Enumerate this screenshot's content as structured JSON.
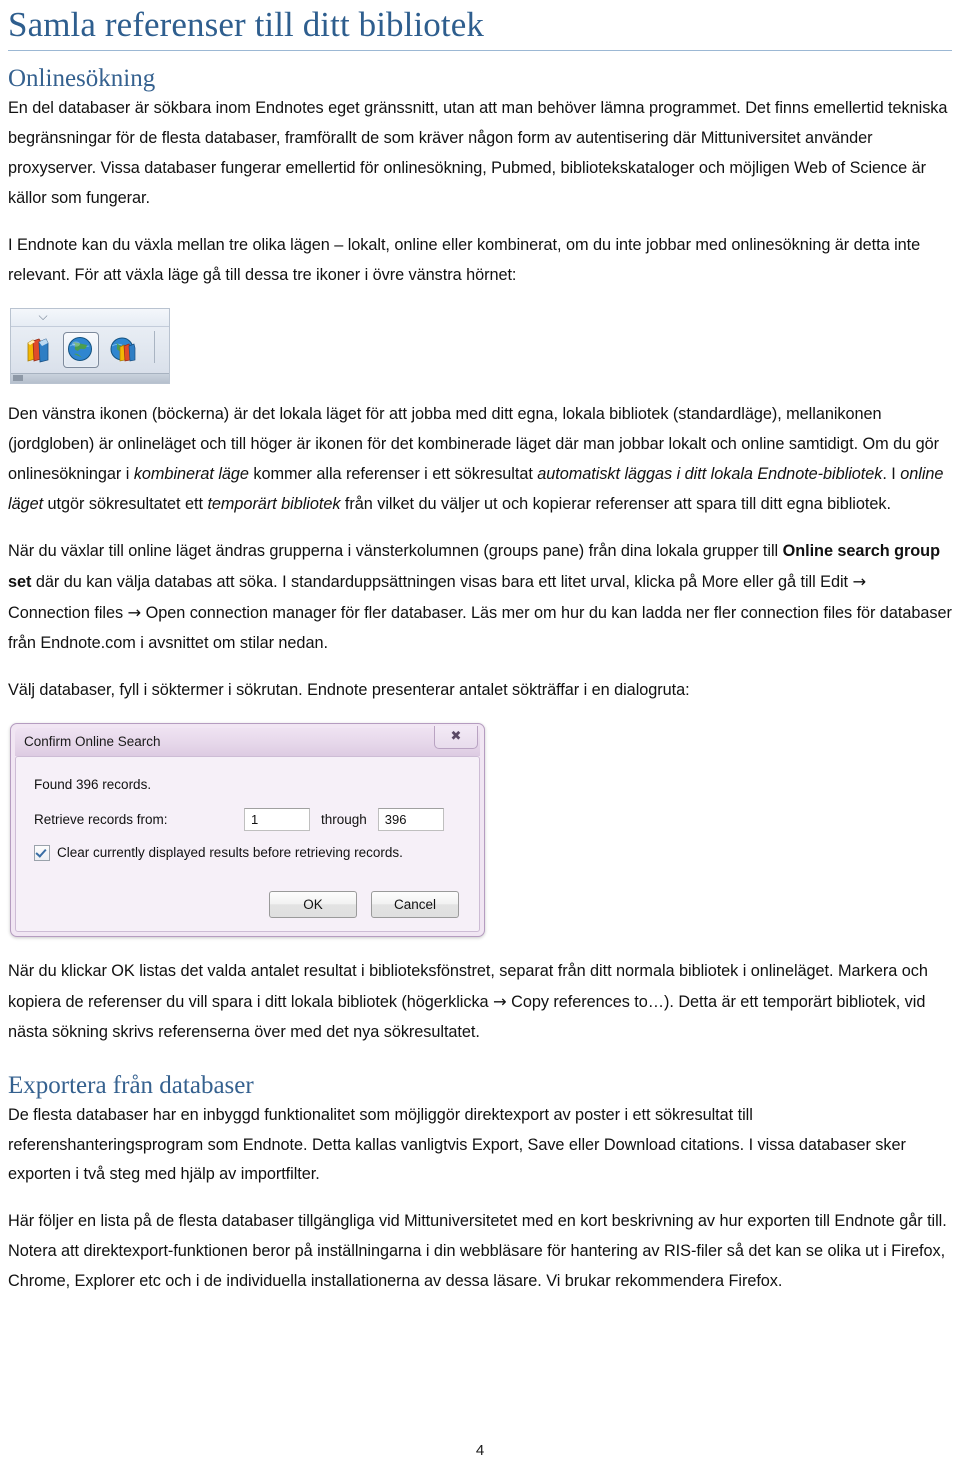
{
  "document": {
    "title": "Samla referenser till ditt bibliotek",
    "page_number": "4",
    "heading_color": "#2E5E8E"
  },
  "sections": {
    "online_search": {
      "heading": "Onlinesökning",
      "p1": "En del databaser är sökbara inom Endnotes eget gränssnitt, utan att man behöver lämna programmet. Det finns emellertid tekniska begränsningar för de flesta databaser, framförallt de som kräver någon form av autentisering där Mittuniversitet använder proxyserver. Vissa databaser fungerar emellertid för onlinesökning, Pubmed, bibliotekskataloger och möjligen Web of Science är källor som fungerar.",
      "p2": "I Endnote kan du växla mellan tre olika lägen – lokalt, online eller kombinerat, om du inte jobbar med onlinesökning är detta inte relevant. För att växla läge gå till dessa tre ikoner i övre vänstra hörnet:",
      "p3_part1": "Den vänstra ikonen (böckerna) är det lokala läget för att jobba med ditt egna, lokala bibliotek (standardläge), mellanikonen (jordgloben) är onlineläget och till höger är ikonen för det kombinerade läget där man jobbar lokalt och online samtidigt. Om du gör onlinesökningar i ",
      "p3_em1": "kombinerat läge",
      "p3_part2": " kommer alla referenser i ett sökresultat ",
      "p3_em2": "automatiskt läggas i ditt lokala Endnote-bibliotek",
      "p3_part3": ". I ",
      "p3_em3": "online läget",
      "p3_part4": " utgör sökresultatet ett ",
      "p3_em4": "temporärt bibliotek",
      "p3_part5": " från vilket du väljer ut och kopierar referenser att spara till ditt egna bibliotek.",
      "p4_part1": "När du växlar till online läget ändras grupperna i vänsterkolumnen (groups pane) från dina lokala grupper till ",
      "p4_strong": "Online search group set",
      "p4_part2": " där du kan välja databas att söka. I standarduppsättningen visas bara ett litet urval, klicka på More eller gå till Edit ",
      "p4_arrow1": "→",
      "p4_part3": " Connection files ",
      "p4_arrow2": "→",
      "p4_part4": " Open connection manager för fler databaser. Läs mer om hur du kan ladda ner fler connection files för databaser från Endnote.com i avsnittet om stilar nedan.",
      "p5": "Välj databaser, fyll i söktermer i sökrutan. Endnote presenterar antalet sökträffar i en dialogruta:",
      "p6_part1": "När du klickar OK listas det valda antalet resultat i biblioteksfönstret, separat från ditt normala bibliotek i onlineläget. Markera och kopiera de referenser du vill spara i ditt lokala bibliotek (högerklicka ",
      "p6_arrow": "→",
      "p6_part2": " Copy references to…). Detta är ett temporärt bibliotek, vid nästa sökning skrivs referenserna över med det nya sökresultatet."
    },
    "export": {
      "heading": "Exportera från databaser",
      "p1": "De flesta databaser har en inbyggd funktionalitet som möjliggör direktexport av poster i ett sökresultat till referenshanteringsprogram som Endnote. Detta kallas vanligtvis Export, Save eller Download citations. I vissa databaser sker exporten i två steg med hjälp av importfilter.",
      "p2": "Här följer en lista på de flesta databaser tillgängliga vid Mittuniversitetet med en kort beskrivning av hur exporten till Endnote går till. Notera att direktexport-funktionen beror på inställningarna i din webbläsare för hantering av RIS-filer så det kan se olika ut i Firefox, Chrome, Explorer etc och i de individuella installationerna av dessa läsare. Vi brukar rekommendera Firefox."
    }
  },
  "toolbar_screenshot": {
    "icons": [
      {
        "name": "local-mode-books-icon",
        "label": "Local Library Mode",
        "selected": false
      },
      {
        "name": "online-mode-globe-icon",
        "label": "Online Search Mode",
        "selected": true
      },
      {
        "name": "integrated-mode-globe-books-icon",
        "label": "Integrated Library & Online Search Mode",
        "selected": false
      }
    ]
  },
  "dialog": {
    "title": "Confirm Online Search",
    "close_glyph": "✖",
    "found_text": "Found 396 records.",
    "retrieve_label": "Retrieve records from:",
    "from_value": "1",
    "through_label": "through",
    "to_value": "396",
    "checkbox_label": "Clear currently displayed results before retrieving records.",
    "checkbox_checked": true,
    "ok_label": "OK",
    "cancel_label": "Cancel"
  }
}
